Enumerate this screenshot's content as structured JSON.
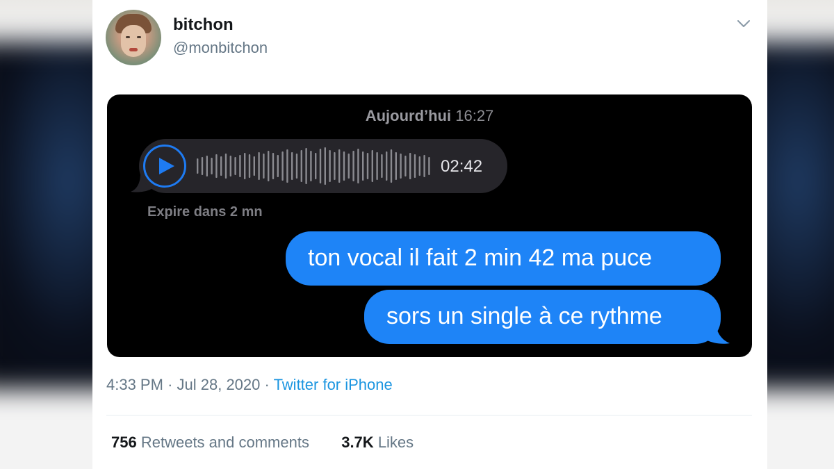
{
  "tweet": {
    "author_name": "bitchon",
    "author_handle": "@monbitchon",
    "time": "4:33 PM",
    "separator": "·",
    "date": "Jul 28, 2020",
    "source": "Twitter for iPhone",
    "retweets_count": "756",
    "retweets_label": "Retweets and comments",
    "likes_count": "3.7K",
    "likes_label": "Likes"
  },
  "media": {
    "timestamp_day": "Aujourd’hui",
    "timestamp_time": "16:27",
    "audio_duration": "02:42",
    "audio_expire": "Expire dans 2 mn",
    "messages": [
      "ton vocal il fait 2 min 42 ma puce",
      "sors un single à ce rythme"
    ]
  },
  "icons": {
    "menu": "chevron-down-icon",
    "play": "play-icon",
    "waveform": "waveform-icon"
  },
  "colors": {
    "accent": "#1b95e0",
    "imessage_blue": "#1e84f7",
    "audio_play": "#1e7bf2"
  }
}
